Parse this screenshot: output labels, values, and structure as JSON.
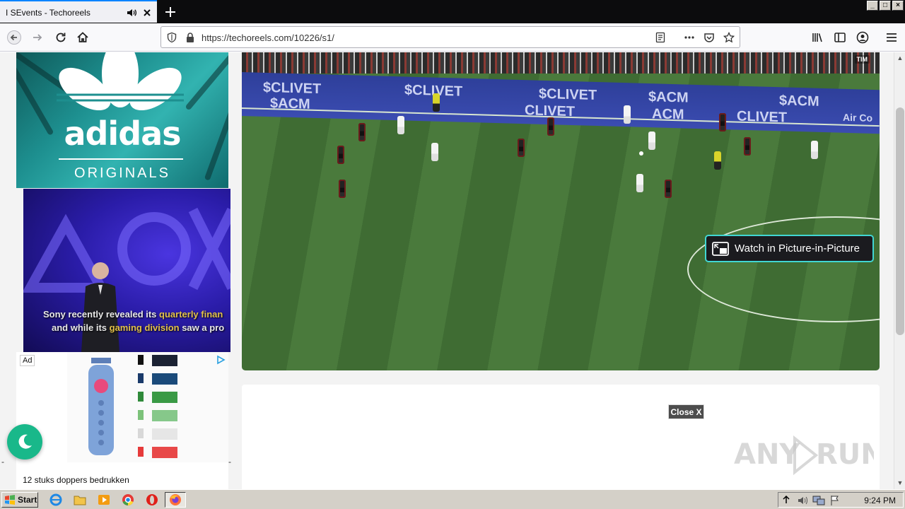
{
  "browser": {
    "tab_title": "I SEvents - Techoreels",
    "url": "https://techoreels.com/10226/s1/"
  },
  "page": {
    "adidas_ad": {
      "brand": "adidas",
      "subline": "ORIGINALS"
    },
    "video_ad": {
      "caption_line1_a": "Sony recently revealed its ",
      "caption_line1_b": "quarterly finan",
      "caption_line2_a": "and while its ",
      "caption_line2_b": "gaming division",
      "caption_line2_c": " saw a pro"
    },
    "display_ad": {
      "badge": "Ad",
      "text": "12 stuks doppers bedrukken"
    },
    "main_video": {
      "pip_label": "Watch in Picture-in-Picture",
      "board_texts": [
        "$CLIVET",
        "$ACM",
        "ACM",
        "CLIVET",
        "$ACM",
        "$CLIVET",
        "Air Co"
      ],
      "broadcaster": "TIM"
    },
    "close_button": "Close X",
    "dash_marks": [
      "-",
      "-",
      "-"
    ],
    "watermark": "ANY RUN"
  },
  "taskbar": {
    "start_label": "Start",
    "clock": "9:24 PM"
  },
  "colors": {
    "accent_tab": "#0a84ff",
    "pip_border": "#41d6d3",
    "toggle": "#19b88a"
  }
}
